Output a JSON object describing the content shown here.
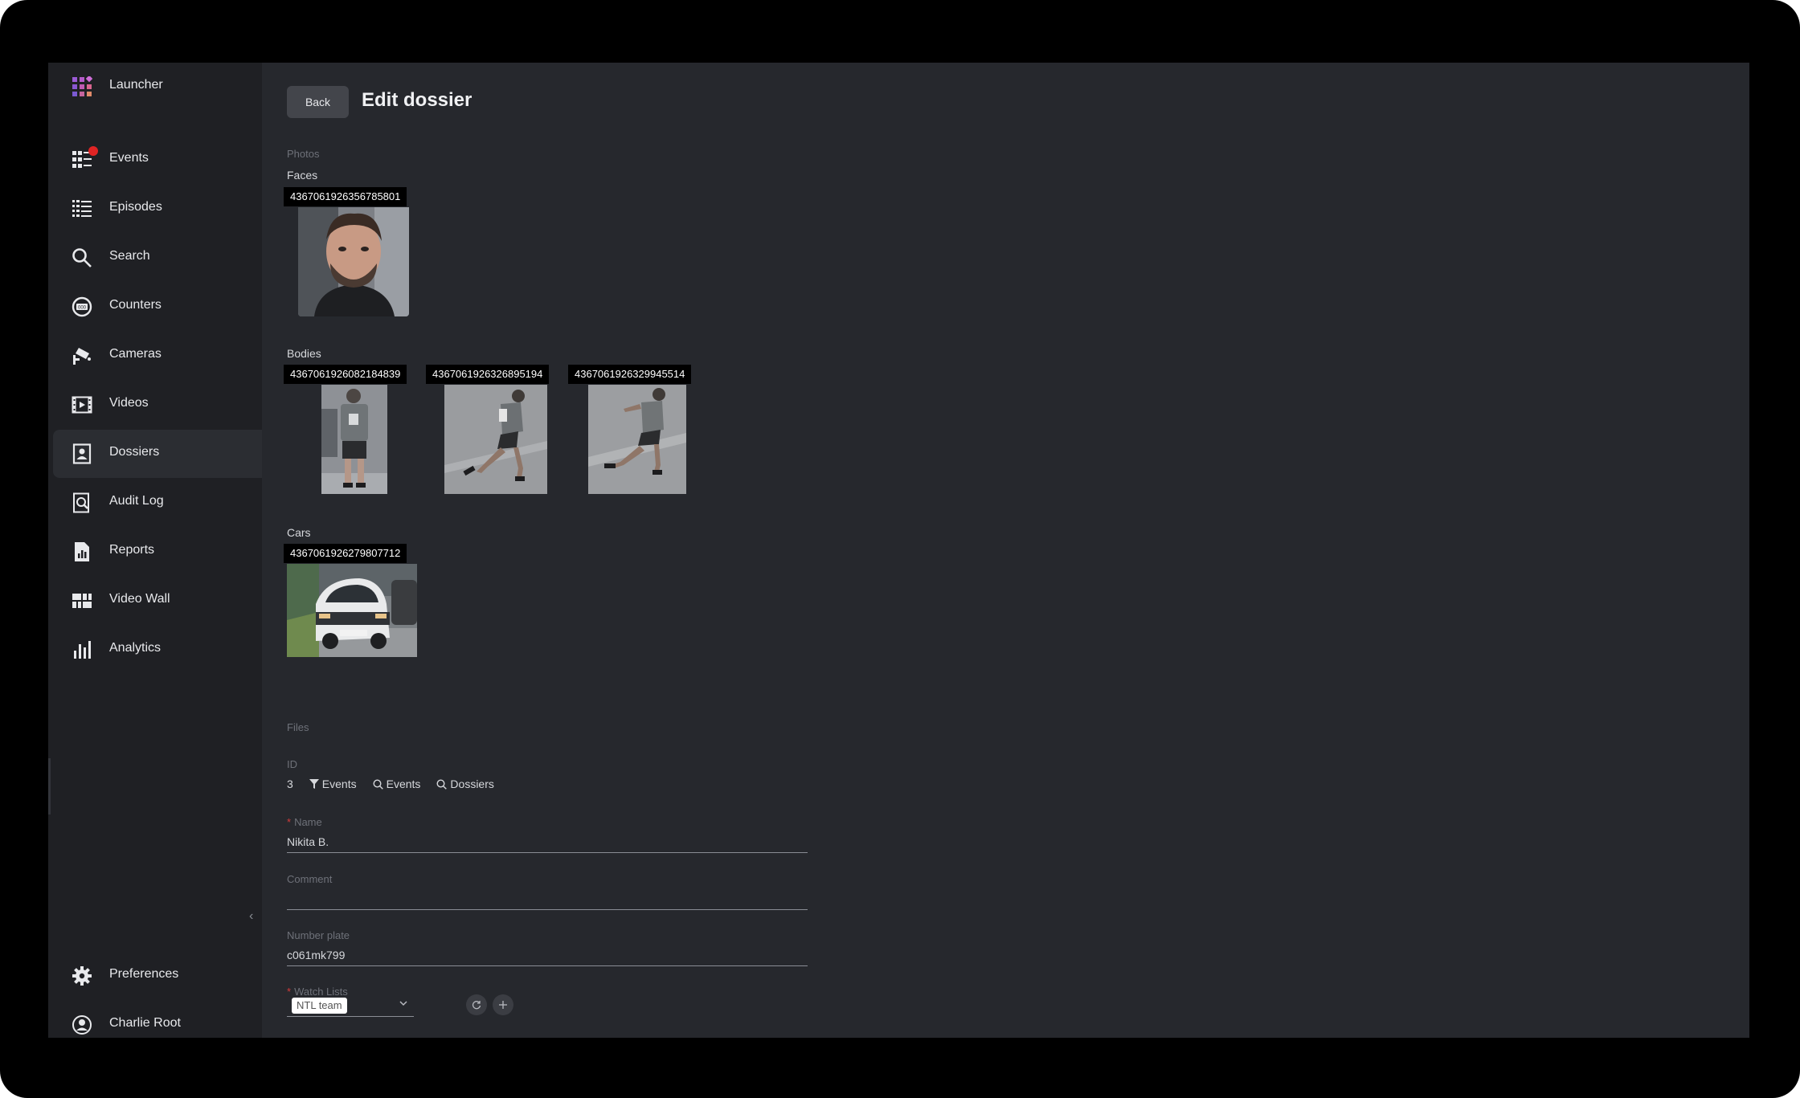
{
  "sidebar": {
    "launcher": "Launcher",
    "items": [
      {
        "label": "Events"
      },
      {
        "label": "Episodes"
      },
      {
        "label": "Search"
      },
      {
        "label": "Counters"
      },
      {
        "label": "Cameras"
      },
      {
        "label": "Videos"
      },
      {
        "label": "Dossiers"
      },
      {
        "label": "Audit Log"
      },
      {
        "label": "Reports"
      },
      {
        "label": "Video Wall"
      },
      {
        "label": "Analytics"
      }
    ],
    "active": "Dossiers",
    "preferences": "Preferences",
    "user": "Charlie Root",
    "collapse_glyph": "‹"
  },
  "header": {
    "back_label": "Back",
    "title": "Edit dossier"
  },
  "photos": {
    "section_label": "Photos",
    "faces_label": "Faces",
    "faces": [
      {
        "id": "4367061926356785801"
      }
    ],
    "bodies_label": "Bodies",
    "bodies": [
      {
        "id": "4367061926082184839"
      },
      {
        "id": "4367061926326895194"
      },
      {
        "id": "4367061926329945514"
      }
    ],
    "cars_label": "Cars",
    "cars": [
      {
        "id": "4367061926279807712"
      }
    ]
  },
  "files": {
    "section_label": "Files"
  },
  "id_block": {
    "label": "ID",
    "value": "3",
    "links": [
      "Events",
      "Events",
      "Dossiers"
    ]
  },
  "form": {
    "name_label": "Name",
    "name_value": "Nikita B.",
    "comment_label": "Comment",
    "comment_value": "",
    "plate_label": "Number plate",
    "plate_value": "c061mk799",
    "watch_lists_label": "Watch Lists",
    "watch_list_selected": "NTL team",
    "required_mark": "*"
  },
  "colors": {
    "background": "#26282d",
    "sidebar": "#1f2024",
    "notification": "#e02424",
    "required": "#d33b3b"
  }
}
